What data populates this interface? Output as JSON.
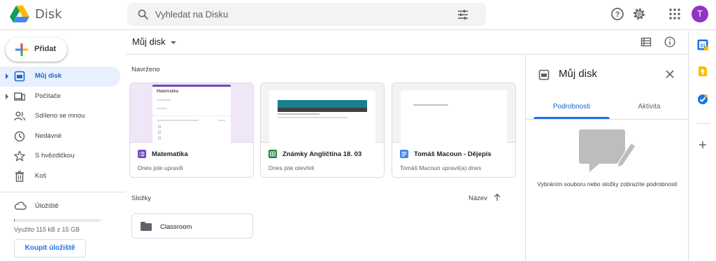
{
  "app": {
    "name": "Disk"
  },
  "search": {
    "placeholder": "Vyhledat na Disku"
  },
  "user": {
    "avatar_letter": "T",
    "avatar_color": "#9334c7"
  },
  "sidebar": {
    "new_label": "Přidat",
    "items": [
      {
        "label": "Můj disk",
        "icon": "my-drive-icon",
        "active": true,
        "expandable": true
      },
      {
        "label": "Počítače",
        "icon": "computers-icon",
        "active": false,
        "expandable": true
      },
      {
        "label": "Sdíleno se mnou",
        "icon": "shared-icon",
        "active": false,
        "expandable": false
      },
      {
        "label": "Nedávné",
        "icon": "clock-icon",
        "active": false,
        "expandable": false
      },
      {
        "label": "S hvězdičkou",
        "icon": "star-icon",
        "active": false,
        "expandable": false
      },
      {
        "label": "Koš",
        "icon": "trash-icon",
        "active": false,
        "expandable": false
      }
    ],
    "storage_label": "Úložiště",
    "storage_used_fraction": 0.01,
    "usage_text": "Využito 115 kB z 15 GB",
    "buy_label": "Koupit úložiště"
  },
  "main": {
    "title": "Můj disk",
    "suggested_label": "Navrženo",
    "cards": [
      {
        "name": "Matematika",
        "subtitle": "Dnes jste upravili",
        "type": "form",
        "type_color": "#7248b9",
        "thumb_title": "Matematika"
      },
      {
        "name": "Známky Angličtina 18. 03",
        "subtitle": "Dnes jste otevřeli",
        "type": "sheet",
        "type_color": "#188038"
      },
      {
        "name": "Tomáš Macoun - Dějepis",
        "subtitle": "Tomáš Macoun upravil(a) dnes",
        "type": "doc",
        "type_color": "#4285f4"
      }
    ],
    "folders_label": "Složky",
    "sort_label": "Název",
    "folders": [
      {
        "name": "Classroom"
      }
    ]
  },
  "details": {
    "title": "Můj disk",
    "tabs": [
      {
        "label": "Podrobnosti",
        "active": true
      },
      {
        "label": "Aktivita",
        "active": false
      }
    ],
    "hint": "Vybráním souboru nebo složky zobrazíte podrobnosti"
  },
  "colors": {
    "accent": "#1a73e8",
    "active_bg": "#e8f0fe",
    "border": "#dadce0"
  }
}
